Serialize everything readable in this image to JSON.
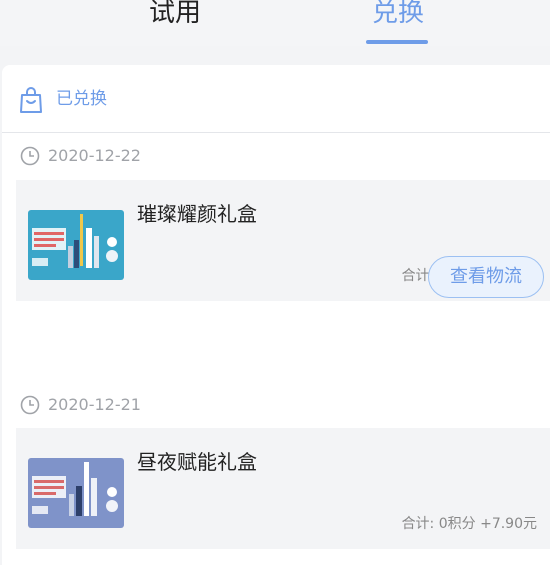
{
  "tabs": [
    {
      "label": "试用",
      "active": false
    },
    {
      "label": "兑换",
      "active": true
    }
  ],
  "header": {
    "label": "已兑换",
    "icon": "shopping-bag-icon"
  },
  "orders": [
    {
      "date": "2020-12-22",
      "product_name": "璀璨耀颜礼盒",
      "total": "合计: 5积分 +7.90元",
      "action_label": "查看物流"
    },
    {
      "date": "2020-12-21",
      "product_name": "昼夜赋能礼盒",
      "total": "合计: 0积分 +7.90元"
    }
  ],
  "colors": {
    "accent": "#6e9ce8",
    "background": "#f3f4f6",
    "text_primary": "#222222",
    "text_muted": "#a0a3a8"
  }
}
